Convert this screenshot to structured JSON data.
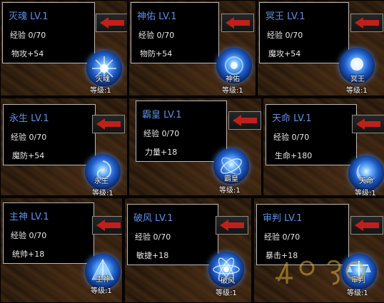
{
  "colors": {
    "title": "#5f8fe0",
    "text": "#e8e8e8",
    "arrow": "#c0201a",
    "tooltip_border": "#b9b9b9"
  },
  "skills": [
    {
      "title": "灭魂 LV.1",
      "exp": "经验 0/70",
      "stat": "物攻+54",
      "orb_label": "灭魂",
      "level": "等级:1",
      "icon": "starburst-orb-icon"
    },
    {
      "title": "神佑 LV.1",
      "exp": "经验 0/70",
      "stat": "物防+54",
      "orb_label": "神佑",
      "level": "等级:1",
      "icon": "blue-sphere-orb-icon"
    },
    {
      "title": "冥王 LV.1",
      "exp": "经验 0/70",
      "stat": "魔攻+54",
      "orb_label": "冥王",
      "level": "等级:1",
      "icon": "glowing-orb-icon"
    },
    {
      "title": "永生 LV.1",
      "exp": "经验 0/70",
      "stat": "魔防+54",
      "orb_label": "永生",
      "level": "等级:1",
      "icon": "swirl-orb-icon"
    },
    {
      "title": "霸皇 LV.1",
      "exp": "经验 0/70",
      "stat": "力量+18",
      "orb_label": "霸皇",
      "level": "等级:1",
      "icon": "vortex-orb-icon"
    },
    {
      "title": "天命 LV.1",
      "exp": "经验 0/70",
      "stat": "生命+180",
      "orb_label": "天命",
      "level": "等级:1",
      "icon": "crescent-orb-icon"
    },
    {
      "title": "主神 LV.1",
      "exp": "经验 0/70",
      "stat": "统帅+18",
      "orb_label": "主神",
      "level": "等级:1",
      "icon": "pyramid-orb-icon"
    },
    {
      "title": "破风 LV.1",
      "exp": "经验 0/70",
      "stat": "敏捷+18",
      "orb_label": "破风",
      "level": "等级:1",
      "icon": "atom-orb-icon"
    },
    {
      "title": "审判 LV.1",
      "exp": "经验 0/70",
      "stat": "暴击+18",
      "orb_label": "审判",
      "level": "等级:1",
      "icon": "scales-orb-icon"
    }
  ],
  "watermark": "4399-logo"
}
